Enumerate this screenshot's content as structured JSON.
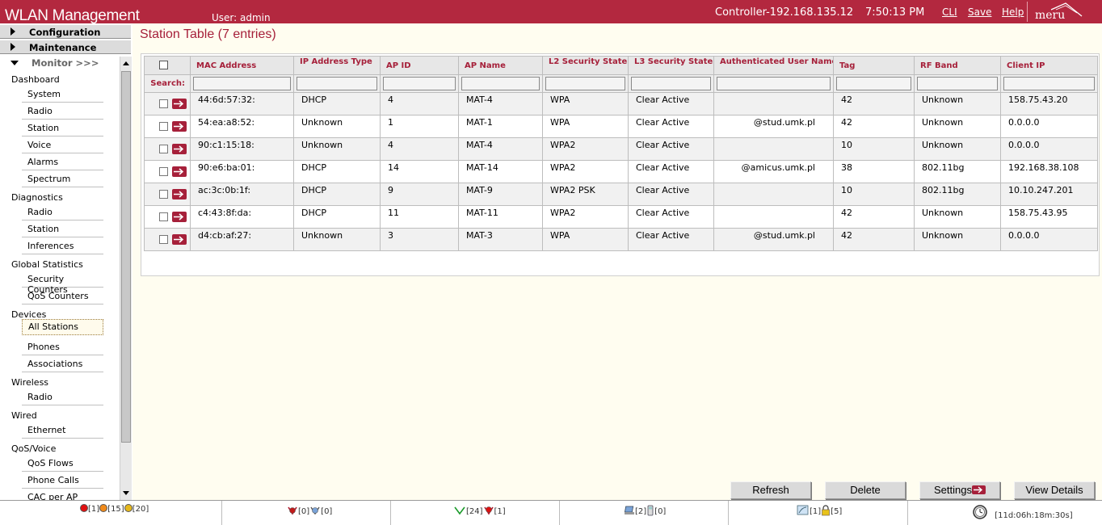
{
  "header": {
    "app_title": "WLAN Management",
    "user": "User: admin",
    "controller": "Controller-192.168.135.12",
    "time": "7:50:13 PM",
    "links": {
      "cli": "CLI",
      "save": "Save",
      "help": "Help"
    },
    "logo_text": "meru"
  },
  "sidebar": {
    "configuration": "Configuration",
    "maintenance": "Maintenance",
    "monitor": "Monitor >>>",
    "groups": {
      "dashboard": "Dashboard",
      "diagnostics": "Diagnostics",
      "global_statistics": "Global Statistics",
      "devices": "Devices",
      "wireless": "Wireless",
      "wired": "Wired",
      "qos_voice": "QoS/Voice"
    },
    "items": {
      "system": "System",
      "radio": "Radio",
      "station": "Station",
      "voice": "Voice",
      "alarms": "Alarms",
      "spectrum": "Spectrum",
      "diag_radio": "Radio",
      "diag_station": "Station",
      "inferences": "Inferences",
      "security_counters": "Security Counters",
      "qos_counters": "QoS Counters",
      "all_stations": "All Stations",
      "phones": "Phones",
      "associations": "Associations",
      "wireless_radio": "Radio",
      "ethernet": "Ethernet",
      "qos_flows": "QoS Flows",
      "phone_calls": "Phone Calls",
      "cac_per_ap": "CAC per AP"
    },
    "selected": "All Stations"
  },
  "main": {
    "title": "Station Table (7 entries)",
    "search_label": "Search:",
    "columns": [
      "MAC Address",
      "IP Address Type",
      "AP ID",
      "AP Name",
      "L2 Security State",
      "L3 Security State",
      "Authenticated User Name",
      "Tag",
      "RF Band",
      "Client IP"
    ],
    "rows": [
      [
        "44:6d:57:32:",
        "DHCP",
        "4",
        "MAT-4",
        "WPA",
        "Clear Active",
        "",
        "42",
        "Unknown",
        "158.75.43.20"
      ],
      [
        "54:ea:a8:52:",
        "Unknown",
        "1",
        "MAT-1",
        "WPA",
        "Clear Active",
        "@stud.umk.pl",
        "42",
        "Unknown",
        "0.0.0.0"
      ],
      [
        "90:c1:15:18:",
        "Unknown",
        "4",
        "MAT-4",
        "WPA2",
        "Clear Active",
        "",
        "10",
        "Unknown",
        "0.0.0.0"
      ],
      [
        "90:e6:ba:01:",
        "DHCP",
        "14",
        "MAT-14",
        "WPA2",
        "Clear Active",
        "@amicus.umk.pl",
        "38",
        "802.11bg",
        "192.168.38.108"
      ],
      [
        "ac:3c:0b:1f:",
        "DHCP",
        "9",
        "MAT-9",
        "WPA2 PSK",
        "Clear Active",
        "",
        "10",
        "802.11bg",
        "10.10.247.201"
      ],
      [
        "c4:43:8f:da:",
        "DHCP",
        "11",
        "MAT-11",
        "WPA2",
        "Clear Active",
        "",
        "42",
        "Unknown",
        "158.75.43.95"
      ],
      [
        "d4:cb:af:27:",
        "Unknown",
        "3",
        "MAT-3",
        "WPA",
        "Clear Active",
        "@stud.umk.pl",
        "42",
        "Unknown",
        "0.0.0.0"
      ]
    ],
    "buttons": {
      "refresh": "Refresh",
      "delete": "Delete",
      "settings": "Settings",
      "view_details": "View Details"
    }
  },
  "statusbar": {
    "alarms": {
      "critical": "[1]",
      "major": "[15]",
      "minor": "[20]"
    },
    "aps_down": "[0]",
    "aps_other": "[0]",
    "aps_up": "[24]",
    "aps_offline": "[1]",
    "stations_wireless": "[2]",
    "stations_phones": "[0]",
    "rogues": "[1]",
    "security": "[5]",
    "uptime": "[11d:06h:18m:30s]"
  },
  "colors": {
    "brand": "#b3283f",
    "accent_text": "#a6203a"
  }
}
